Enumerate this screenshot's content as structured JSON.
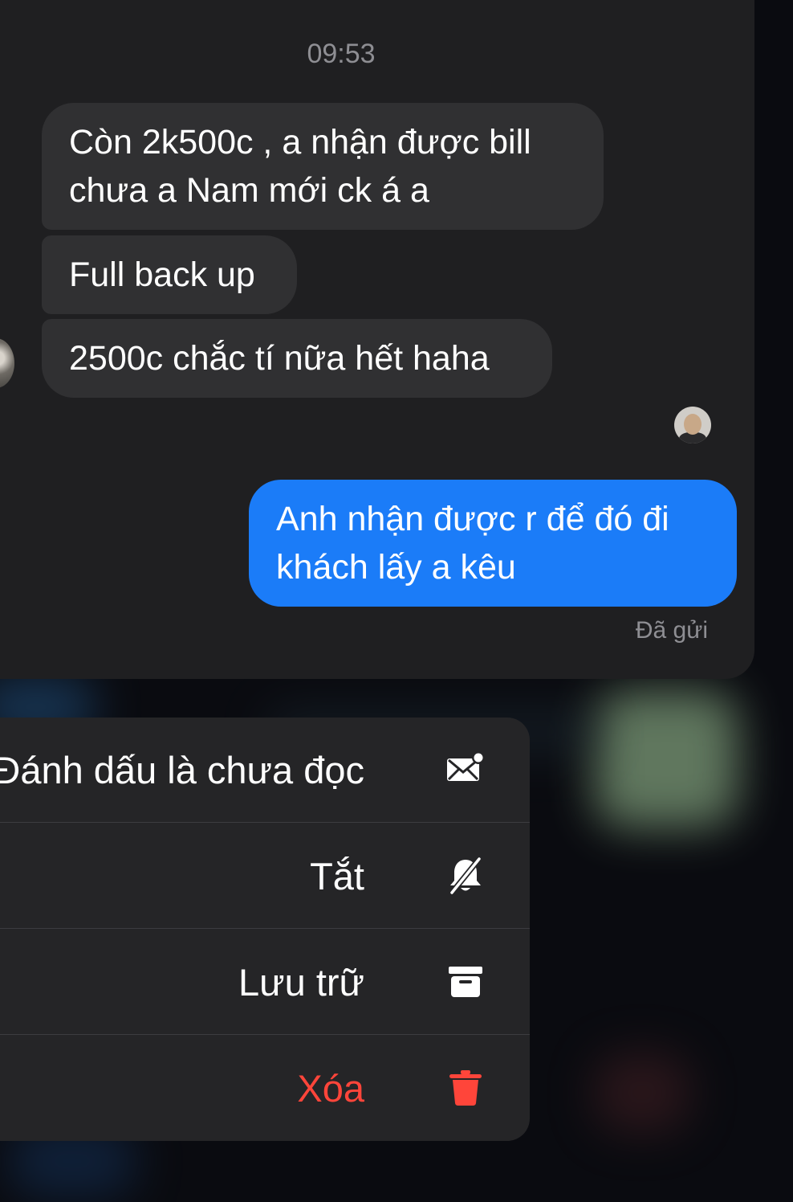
{
  "conversation": {
    "timestamp": "09:53",
    "messages": [
      {
        "direction": "incoming",
        "text": "Còn 2k500c , a nhận được bill chưa a Nam mới ck á a"
      },
      {
        "direction": "incoming",
        "text": "Full back up"
      },
      {
        "direction": "incoming",
        "text": "2500c chắc tí nữa hết haha"
      },
      {
        "direction": "outgoing",
        "text": "Anh nhận được r để đó đi khách lấy a kêu"
      }
    ],
    "status": "Đã gửi"
  },
  "context_menu": {
    "items": [
      {
        "label": "Đánh dấu là chưa đọc",
        "icon": "envelope-badge-icon"
      },
      {
        "label": "Tắt",
        "icon": "bell-slash-icon"
      },
      {
        "label": "Lưu trữ",
        "icon": "archive-box-icon"
      },
      {
        "label": "Xóa",
        "icon": "trash-icon",
        "destructive": true
      }
    ]
  },
  "colors": {
    "outgoing_bubble": "#1b7cf8",
    "incoming_bubble": "#303032",
    "destructive": "#ff453a"
  }
}
